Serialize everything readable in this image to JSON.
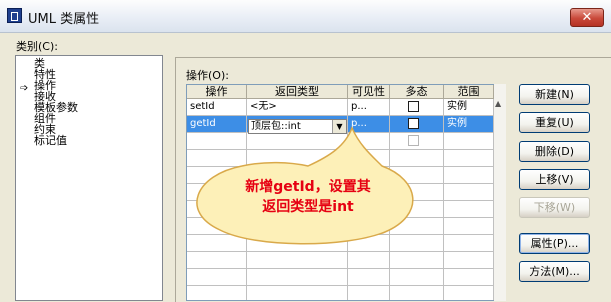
{
  "window": {
    "title": "UML 类属性",
    "close_glyph": "✕"
  },
  "category": {
    "label": "类别(C):",
    "items": [
      "类",
      "特性",
      "操作",
      "接收",
      "模板参数",
      "组件",
      "约束",
      "标记值"
    ],
    "selected_index": 2
  },
  "operations": {
    "label": "操作(O):",
    "columns": [
      "操作",
      "返回类型",
      "可见性",
      "多态",
      "范围"
    ],
    "rows": [
      {
        "name": "setId",
        "return_type": "<无>",
        "visibility": "p...",
        "polymorphic": false,
        "scope": "实例",
        "selected": false
      },
      {
        "name": "getId",
        "return_type": "顶层包::int",
        "visibility": "p...",
        "polymorphic": false,
        "scope": "实例",
        "selected": true
      }
    ]
  },
  "buttons": {
    "new": "新建(N)",
    "duplicate": "重复(U)",
    "delete": "删除(D)",
    "move_up": "上移(V)",
    "move_down": "下移(W)",
    "properties": "属性(P)...",
    "methods": "方法(M)..."
  },
  "callout": {
    "line1": "新增getId，设置其",
    "line2": "返回类型是int",
    "color": "#e60012",
    "fill": "#fdf0b8"
  }
}
